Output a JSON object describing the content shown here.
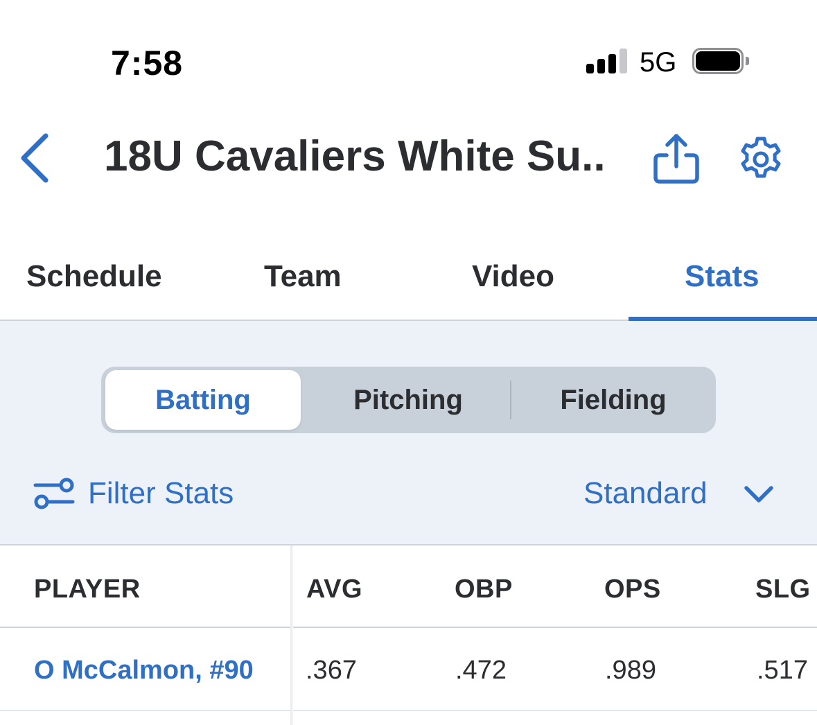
{
  "status_bar": {
    "time": "7:58",
    "network": "5G",
    "icons": [
      "signal-icon",
      "battery-icon"
    ]
  },
  "header": {
    "title": "18U Cavaliers White Su...",
    "icons": [
      "back-chevron-icon",
      "share-icon",
      "gear-icon"
    ]
  },
  "tabs": [
    {
      "label": "Schedule",
      "active": false
    },
    {
      "label": "Team",
      "active": false
    },
    {
      "label": "Video",
      "active": false
    },
    {
      "label": "Stats",
      "active": true
    }
  ],
  "stats": {
    "segments": [
      {
        "label": "Batting",
        "selected": true
      },
      {
        "label": "Pitching",
        "selected": false
      },
      {
        "label": "Fielding",
        "selected": false
      }
    ],
    "filter_label": "Filter Stats",
    "view_select": "Standard"
  },
  "table": {
    "columns": [
      "PLAYER",
      "AVG",
      "OBP",
      "OPS",
      "SLG"
    ],
    "rows": [
      {
        "player": "O McCalmon, #90",
        "avg": ".367",
        "obp": ".472",
        "ops": ".989",
        "slg": ".517"
      }
    ]
  },
  "colors": {
    "accent": "#2f6fc6",
    "text": "#2b2d31",
    "panel_bg": "#edf1f8",
    "segment_bg": "#c8d0da"
  }
}
